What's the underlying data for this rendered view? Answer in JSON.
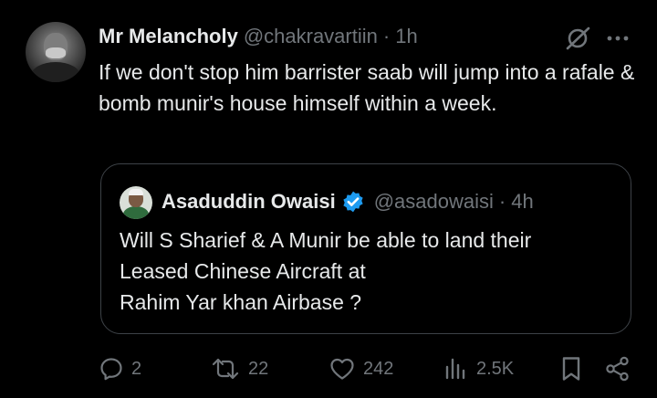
{
  "tweet": {
    "author_name": "Mr Melancholy",
    "handle": "@chakravartiin",
    "separator": "·",
    "time": "1h",
    "text": "If we don't stop him barrister saab will jump into a rafale & bomb munir's house himself within a week.",
    "icons": [
      "grok-icon",
      "more-icon"
    ]
  },
  "quoted": {
    "author_name": "Asaduddin Owaisi",
    "handle": "@asadowaisi",
    "separator": "·",
    "time": "4h",
    "text_lines": [
      "Will S Sharief & A Munir be able to  land their",
      "Leased Chinese Aircraft at",
      "Rahim Yar khan Airbase ?"
    ],
    "verified": true
  },
  "actions": {
    "replies": "2",
    "reposts": "22",
    "likes": "242",
    "views": "2.5K"
  },
  "colors": {
    "background": "#000000",
    "text": "#e7e9ea",
    "muted": "#71767b",
    "border": "#3d4247",
    "verified": "#1d9bf0"
  }
}
